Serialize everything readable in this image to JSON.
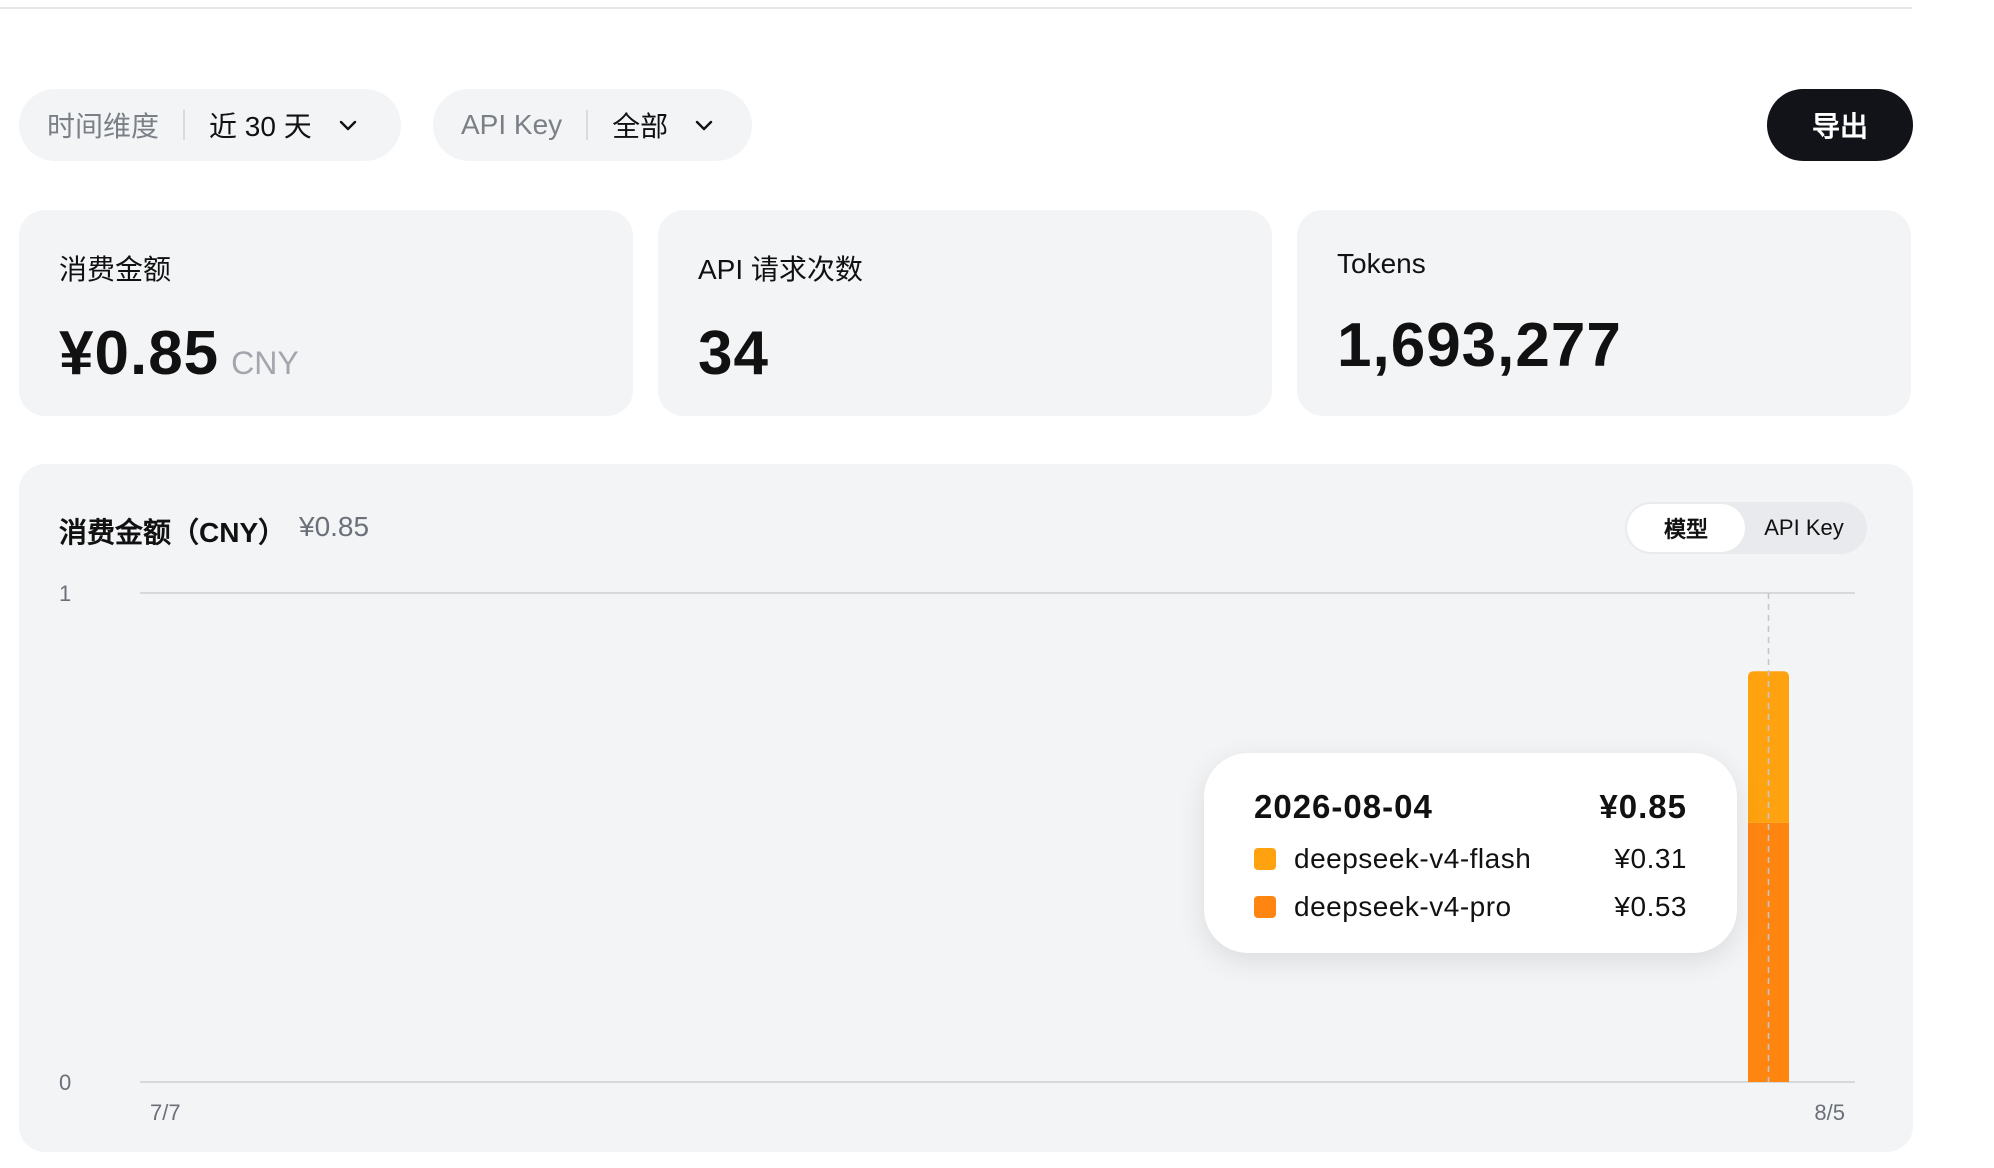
{
  "filters": {
    "time": {
      "label": "时间维度",
      "value": "近 30 天"
    },
    "api_key": {
      "label": "API Key",
      "value": "全部"
    },
    "export_label": "导出"
  },
  "stats": {
    "cost": {
      "title": "消费金额",
      "value": "¥0.85",
      "unit": "CNY"
    },
    "requests": {
      "title": "API 请求次数",
      "value": "34"
    },
    "tokens": {
      "title": "Tokens",
      "value": "1,693,277"
    }
  },
  "chart_panel": {
    "title": "消费金额（CNY）",
    "total": "¥0.85",
    "toggle": {
      "model": "模型",
      "api_key": "API Key",
      "selected": "模型"
    }
  },
  "tooltip": {
    "date": "2026-08-04",
    "total": "¥0.85",
    "rows": [
      {
        "name": "deepseek-v4-flash",
        "value": "¥0.31",
        "color": "#FFA20F"
      },
      {
        "name": "deepseek-v4-pro",
        "value": "¥0.53",
        "color": "#FF8511"
      }
    ]
  },
  "chart_data": {
    "type": "bar",
    "stacked": true,
    "x_start": "7/7",
    "x_end": "8/5",
    "x_tick_labels": [
      "7/7",
      "8/5"
    ],
    "ylim": [
      0,
      1
    ],
    "y_tick_labels": [
      "1",
      "0"
    ],
    "categories": [
      "2026-08-04"
    ],
    "series": [
      {
        "name": "deepseek-v4-pro",
        "values": [
          0.53
        ],
        "color": "#FF8511"
      },
      {
        "name": "deepseek-v4-flash",
        "values": [
          0.31
        ],
        "color": "#FFA20F"
      }
    ],
    "hover_category": "2026-08-04"
  }
}
